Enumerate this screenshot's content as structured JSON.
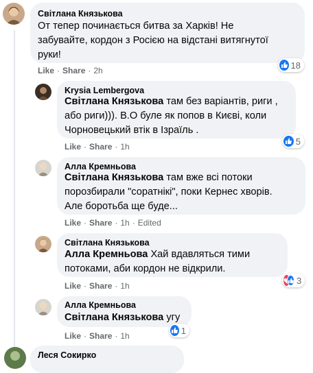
{
  "colors": {
    "bubble": "#f0f2f5",
    "link": "#65676b",
    "like": "#1877f2",
    "heart": "#f33e58"
  },
  "actions": {
    "like": "Like",
    "share": "Share",
    "dot": "·"
  },
  "comments": [
    {
      "author": "Світлана Князькова",
      "lines": [
        "От тепер починається битва за Харків! Не",
        "забувайте, кордон з Росією на відстані витягнутої",
        "руки!"
      ],
      "time": "2h",
      "reactions": "18"
    },
    {
      "author": "Krysia Lembergova",
      "mention": "Світлана Князькова",
      "line1": " там без варіантів, риги ,",
      "lines": [
        "або риги))). В.О буле як попов в Києві, коли",
        "Чорновецький втік в Ізраїль ."
      ],
      "time": "1h",
      "reactions": "5"
    },
    {
      "author": "Алла Кремньова",
      "mention": "Світлана Князькова",
      "line1": " там вже всі потоки",
      "lines": [
        "порозбирали \"соратнікі\", поки Кернес хворів.",
        "Але боротьба ще буде..."
      ],
      "time": "1h",
      "edited": "Edited"
    },
    {
      "author": "Світлана Князькова",
      "mention": "Алла Кремньова",
      "line1": " Хай вдавляться тими",
      "lines": [
        "потоками, аби кордон не відкрили."
      ],
      "time": "1h",
      "reactions": "3"
    },
    {
      "author": "Алла Кремньова",
      "mention": "Світлана Князькова",
      "line1": " угу",
      "time": "1h",
      "reactions": "1"
    },
    {
      "author": "Леся Сокирко"
    }
  ]
}
